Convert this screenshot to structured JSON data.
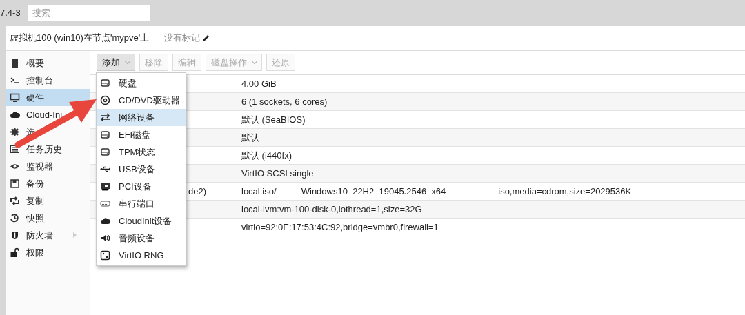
{
  "topbar": {
    "version": "7.4-3",
    "search": {
      "placeholder": "搜索"
    }
  },
  "header": {
    "title": "虚拟机100 (win10)在节点'mypve'上",
    "tags": "没有标记"
  },
  "sidebar": {
    "items": [
      {
        "label": "概要",
        "selected": false,
        "expandable": false
      },
      {
        "label": "控制台",
        "selected": false,
        "expandable": false
      },
      {
        "label": "硬件",
        "selected": true,
        "expandable": false
      },
      {
        "label": "Cloud-Ini",
        "selected": false,
        "expandable": false
      },
      {
        "label": "选",
        "selected": false,
        "expandable": false
      },
      {
        "label": "任务历史",
        "selected": false,
        "expandable": false
      },
      {
        "label": "监视器",
        "selected": false,
        "expandable": false
      },
      {
        "label": "备份",
        "selected": false,
        "expandable": false
      },
      {
        "label": "复制",
        "selected": false,
        "expandable": false
      },
      {
        "label": "快照",
        "selected": false,
        "expandable": false
      },
      {
        "label": "防火墙",
        "selected": false,
        "expandable": true
      },
      {
        "label": "权限",
        "selected": false,
        "expandable": false
      }
    ]
  },
  "toolbar": {
    "buttons": [
      {
        "label": "添加",
        "disabled": false,
        "dropdown": true
      },
      {
        "label": "移除",
        "disabled": true,
        "dropdown": false
      },
      {
        "label": "编辑",
        "disabled": true,
        "dropdown": false
      },
      {
        "label": "磁盘操作",
        "disabled": true,
        "dropdown": true
      },
      {
        "label": "还原",
        "disabled": true,
        "dropdown": false
      }
    ]
  },
  "table": {
    "rows": [
      {
        "value": "4.00 GiB"
      },
      {
        "value": "6 (1 sockets, 6 cores)"
      },
      {
        "value": "默认 (SeaBIOS)"
      },
      {
        "value": "默认"
      },
      {
        "value": "默认 (i440fx)"
      },
      {
        "value": "VirtIO SCSI single"
      },
      {
        "key": "de2)",
        "value": "local:iso/_____Windows10_22H2_19045.2546_x64__________.iso,media=cdrom,size=2029536K"
      },
      {
        "value": "local-lvm:vm-100-disk-0,iothread=1,size=32G"
      },
      {
        "value": "virtio=92:0E:17:53:4C:92,bridge=vmbr0,firewall=1"
      }
    ]
  },
  "add_menu": {
    "items": [
      {
        "label": "硬盘",
        "selected": false
      },
      {
        "label": "CD/DVD驱动器",
        "selected": false
      },
      {
        "label": "网络设备",
        "selected": true
      },
      {
        "label": "EFI磁盘",
        "selected": false
      },
      {
        "label": "TPM状态",
        "selected": false
      },
      {
        "label": "USB设备",
        "selected": false
      },
      {
        "label": "PCI设备",
        "selected": false
      },
      {
        "label": "串行端口",
        "selected": false
      },
      {
        "label": "CloudInit设备",
        "selected": false
      },
      {
        "label": "音频设备",
        "selected": false
      },
      {
        "label": "VirtIO RNG",
        "selected": false
      }
    ]
  }
}
